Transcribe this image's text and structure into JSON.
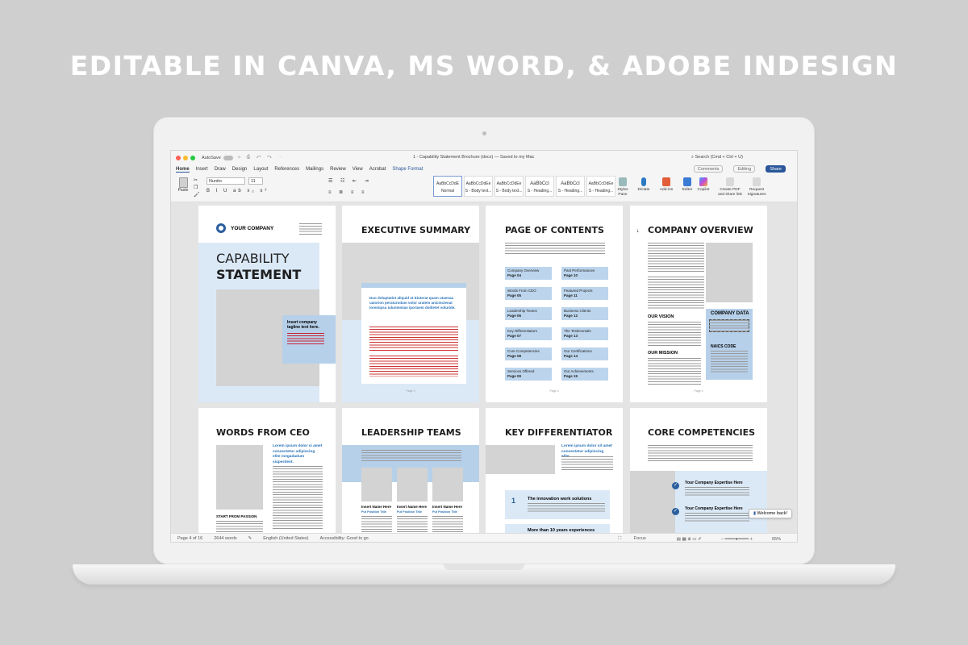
{
  "headline": "EDITABLE IN CANVA, MS WORD, & ADOBE INDESIGN",
  "window": {
    "autosave": "AutoSave",
    "doc_title": "1 - Capability Statement Brochure (docx) — Saved to my Mac",
    "search": "Search (Cmd + Ctrl + U)"
  },
  "menu": {
    "items": [
      "Home",
      "Insert",
      "Draw",
      "Design",
      "Layout",
      "References",
      "Mailings",
      "Review",
      "View",
      "Acrobat"
    ],
    "shape_format": "Shape Format",
    "comments": "Comments",
    "editing": "Editing",
    "share": "Share"
  },
  "ribbon": {
    "paste": "Paste",
    "font": "Nunito",
    "size": "11",
    "format_glyphs": "B I U ab x₂ x²",
    "styles": [
      {
        "preview": "AaBbCcDdE",
        "name": "Normal"
      },
      {
        "preview": "AaBbCcDdEe",
        "name": "S - Body text..."
      },
      {
        "preview": "AaBbCcDdEe",
        "name": "S - Body text..."
      },
      {
        "preview": "AaBbCcI",
        "name": "S - Heading..."
      },
      {
        "preview": "AaBbCcI",
        "name": "S - Heading..."
      },
      {
        "preview": "AaBbCcDdEe",
        "name": "S - Heading..."
      }
    ],
    "styles_pane": "Styles Pane",
    "dictate": "Dictate",
    "addins": "Add-ins",
    "editor": "Editor",
    "copilot": "Copilot",
    "create_pdf": "Create PDF and share link",
    "request_sig": "Request Signatures"
  },
  "pages": {
    "cover": {
      "company": "YOUR COMPANY",
      "title1": "CAPABILITY",
      "title2": "STATEMENT",
      "tagline": "Insert company tagline text here."
    },
    "exec": {
      "title": "EXECUTIVE SUMMARY",
      "quote": "Duo doluptatint aliquid ut Eiuterat quam utaenaa uaiorion peraturodum volor uratem anicinctenat loremipsu iuluntemias iporiaem dolitetet voluride.",
      "page": "Page 2"
    },
    "toc": {
      "title": "PAGE OF CONTENTS",
      "entries": [
        [
          "Company Overview",
          "Page 04"
        ],
        [
          "Past Performances",
          "Page 10"
        ],
        [
          "Words From CEO",
          "Page 05"
        ],
        [
          "Featured Projects",
          "Page 11"
        ],
        [
          "Leadership Teams",
          "Page 06"
        ],
        [
          "Business Clients",
          "Page 12"
        ],
        [
          "Key Differentiators",
          "Page 07"
        ],
        [
          "The Testimonials",
          "Page 13"
        ],
        [
          "Core Competencies",
          "Page 08"
        ],
        [
          "Our Certifications",
          "Page 14"
        ],
        [
          "Services Offered",
          "Page 09"
        ],
        [
          "Our Achievements",
          "Page 15"
        ]
      ],
      "page": "Page 3"
    },
    "overview": {
      "title": "COMPANY OVERVIEW",
      "vision": "OUR VISION",
      "mission": "OUR MISSION",
      "data": "COMPANY DATA",
      "naics": "NAICS CODE",
      "page": "Page 4"
    },
    "ceo": {
      "title": "WORDS FROM CEO",
      "lead": "Lorem ipsum dolor si amet consectetur adipiscing elite megadadum siuperdent.",
      "sub": "START FROM PASSION"
    },
    "leaders": {
      "title": "LEADERSHIP TEAMS",
      "name": "Insert Name Here",
      "position": "Put Position Title"
    },
    "diff": {
      "title": "KEY DIFFERENTIATOR",
      "lead": "Lorem ipsum dolor sit amet consectetur adipiscing elite.",
      "item1": "The innovation work solutions",
      "item2": "More than 10 years experiences"
    },
    "core": {
      "title": "CORE COMPETENCIES",
      "item": "Your Company Expertise Here"
    }
  },
  "status": {
    "page": "Page 4 of 16",
    "words": "2644 words",
    "lang": "English (United States)",
    "access": "Accessibility: Good to go",
    "focus": "Focus",
    "zoom": "65%",
    "welcome": "Welcome back!"
  },
  "colors": {
    "accent": "#2b579a",
    "light_blue": "#dbe9f7",
    "mid_blue": "#b6d0ea"
  }
}
